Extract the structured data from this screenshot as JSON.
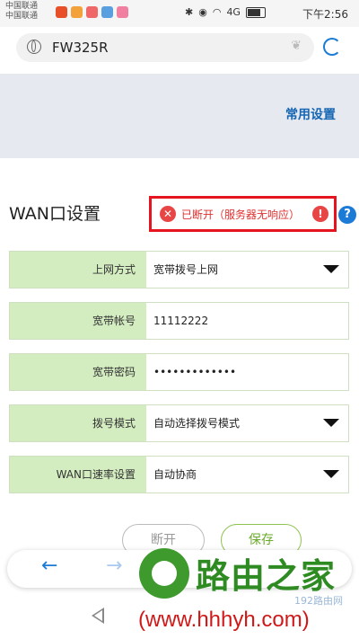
{
  "statusbar": {
    "carrier1": "中国联通",
    "carrier2": "中国联通",
    "signal_label": "4G",
    "time": "下午2:56"
  },
  "browser": {
    "url": "FW325R",
    "back_icon": "arrow-left-icon",
    "forward_icon": "arrow-right-icon"
  },
  "header": {
    "common_settings": "常用设置"
  },
  "wan": {
    "title": "WAN口设置",
    "status": "已断开（服务器无响应）",
    "rows": [
      {
        "label": "上网方式",
        "value": "宽带拨号上网"
      },
      {
        "label": "宽带帐号",
        "value": "11112222"
      },
      {
        "label": "宽带密码",
        "value": "•••••••••••••"
      },
      {
        "label": "拨号模式",
        "value": "自动选择拨号模式"
      },
      {
        "label": "WAN口速率设置",
        "value": "自动协商"
      }
    ]
  },
  "buttons": {
    "disconnect": "断开",
    "save": "保存"
  },
  "watermark": {
    "name": "路由之家",
    "sub": "192路由网",
    "url": "(www.hhhyh.com)"
  },
  "colors": {
    "accent": "#1c7bd6",
    "label_bg": "#d3edc0",
    "alert": "#e6141e"
  }
}
